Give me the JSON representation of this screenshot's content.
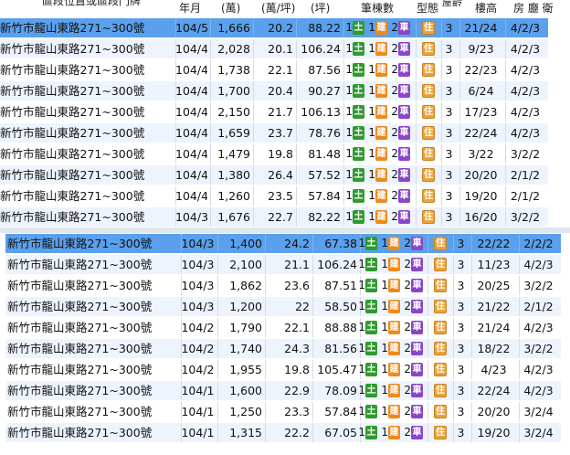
{
  "header": {
    "address": "區段位置或區段門牌",
    "year_month": "年月",
    "total_price": "(萬)",
    "unit_price": "(萬/坪)",
    "area": "(坪)",
    "counts": "筆棟數",
    "type": "型態",
    "age": "屋齡",
    "floor": "樓高",
    "layout": "房 廳 衛"
  },
  "top_table": {
    "rows": [
      {
        "address": "新竹市龍山東路271~300號",
        "ym": "104/5",
        "total": "1,666",
        "unit": "20.2",
        "area": "88.22",
        "land": "1",
        "land_icon": "土",
        "build": "1",
        "build_icon": "建",
        "car": "2",
        "car_icon": "車",
        "type": "住",
        "age": "3",
        "floor": "21/24",
        "layout": "4/2/3",
        "selected": true
      },
      {
        "address": "新竹市龍山東路271~300號",
        "ym": "104/4",
        "total": "2,028",
        "unit": "20.1",
        "area": "106.24",
        "land": "1",
        "land_icon": "土",
        "build": "1",
        "build_icon": "建",
        "car": "2",
        "car_icon": "車",
        "type": "住",
        "age": "3",
        "floor": "9/23",
        "layout": "4/2/3"
      },
      {
        "address": "新竹市龍山東路271~300號",
        "ym": "104/4",
        "total": "1,738",
        "unit": "22.1",
        "area": "87.56",
        "land": "1",
        "land_icon": "土",
        "build": "1",
        "build_icon": "建",
        "car": "2",
        "car_icon": "車",
        "type": "住",
        "age": "3",
        "floor": "22/23",
        "layout": "4/2/3"
      },
      {
        "address": "新竹市龍山東路271~300號",
        "ym": "104/4",
        "total": "1,700",
        "unit": "20.4",
        "area": "90.27",
        "land": "1",
        "land_icon": "土",
        "build": "1",
        "build_icon": "建",
        "car": "2",
        "car_icon": "車",
        "type": "住",
        "age": "3",
        "floor": "6/24",
        "layout": "4/2/3"
      },
      {
        "address": "新竹市龍山東路271~300號",
        "ym": "104/4",
        "total": "2,150",
        "unit": "21.7",
        "area": "106.13",
        "land": "1",
        "land_icon": "土",
        "build": "1",
        "build_icon": "建",
        "car": "2",
        "car_icon": "車",
        "type": "住",
        "age": "3",
        "floor": "17/23",
        "layout": "4/2/3"
      },
      {
        "address": "新竹市龍山東路271~300號",
        "ym": "104/4",
        "total": "1,659",
        "unit": "23.7",
        "area": "78.76",
        "land": "1",
        "land_icon": "土",
        "build": "1",
        "build_icon": "建",
        "car": "2",
        "car_icon": "車",
        "type": "住",
        "age": "3",
        "floor": "22/24",
        "layout": "4/2/3"
      },
      {
        "address": "新竹市龍山東路271~300號",
        "ym": "104/4",
        "total": "1,479",
        "unit": "19.8",
        "area": "81.48",
        "land": "1",
        "land_icon": "土",
        "build": "1",
        "build_icon": "建",
        "car": "2",
        "car_icon": "車",
        "type": "住",
        "age": "3",
        "floor": "3/22",
        "layout": "3/2/2"
      },
      {
        "address": "新竹市龍山東路271~300號",
        "ym": "104/4",
        "total": "1,380",
        "unit": "26.4",
        "area": "57.52",
        "land": "1",
        "land_icon": "土",
        "build": "1",
        "build_icon": "建",
        "car": "2",
        "car_icon": "車",
        "type": "住",
        "age": "3",
        "floor": "20/20",
        "layout": "2/1/2"
      },
      {
        "address": "新竹市龍山東路271~300號",
        "ym": "104/4",
        "total": "1,260",
        "unit": "23.5",
        "area": "57.84",
        "land": "1",
        "land_icon": "土",
        "build": "1",
        "build_icon": "建",
        "car": "2",
        "car_icon": "車",
        "type": "住",
        "age": "3",
        "floor": "19/20",
        "layout": "2/1/2"
      },
      {
        "address": "新竹市龍山東路271~300號",
        "ym": "104/3",
        "total": "1,676",
        "unit": "22.7",
        "area": "82.22",
        "land": "1",
        "land_icon": "土",
        "build": "1",
        "build_icon": "建",
        "car": "2",
        "car_icon": "車",
        "type": "住",
        "age": "3",
        "floor": "16/20",
        "layout": "3/2/2"
      }
    ]
  },
  "bottom_table": {
    "rows": [
      {
        "address": "新竹市龍山東路271~300號",
        "ym": "104/3",
        "total": "1,400",
        "unit": "24.2",
        "area": "67.38",
        "land": "1",
        "land_icon": "土",
        "build": "1",
        "build_icon": "建",
        "car": "2",
        "car_icon": "車",
        "type": "住",
        "age": "3",
        "floor": "22/22",
        "layout": "2/2/2",
        "selected": true
      },
      {
        "address": "新竹市龍山東路271~300號",
        "ym": "104/3",
        "total": "2,100",
        "unit": "21.1",
        "area": "106.24",
        "land": "1",
        "land_icon": "土",
        "build": "1",
        "build_icon": "建",
        "car": "2",
        "car_icon": "車",
        "type": "住",
        "age": "3",
        "floor": "11/23",
        "layout": "4/2/3"
      },
      {
        "address": "新竹市龍山東路271~300號",
        "ym": "104/3",
        "total": "1,862",
        "unit": "23.6",
        "area": "87.51",
        "land": "1",
        "land_icon": "土",
        "build": "1",
        "build_icon": "建",
        "car": "2",
        "car_icon": "車",
        "type": "住",
        "age": "3",
        "floor": "20/25",
        "layout": "3/2/2"
      },
      {
        "address": "新竹市龍山東路271~300號",
        "ym": "104/3",
        "total": "1,200",
        "unit": "22",
        "area": "58.50",
        "land": "1",
        "land_icon": "土",
        "build": "1",
        "build_icon": "建",
        "car": "2",
        "car_icon": "車",
        "type": "住",
        "age": "3",
        "floor": "21/22",
        "layout": "2/1/2"
      },
      {
        "address": "新竹市龍山東路271~300號",
        "ym": "104/2",
        "total": "1,790",
        "unit": "22.1",
        "area": "88.88",
        "land": "1",
        "land_icon": "土",
        "build": "1",
        "build_icon": "建",
        "car": "2",
        "car_icon": "車",
        "type": "住",
        "age": "3",
        "floor": "21/24",
        "layout": "4/2/3"
      },
      {
        "address": "新竹市龍山東路271~300號",
        "ym": "104/2",
        "total": "1,740",
        "unit": "24.3",
        "area": "81.56",
        "land": "1",
        "land_icon": "土",
        "build": "1",
        "build_icon": "建",
        "car": "2",
        "car_icon": "車",
        "type": "住",
        "age": "3",
        "floor": "18/22",
        "layout": "3/2/2"
      },
      {
        "address": "新竹市龍山東路271~300號",
        "ym": "104/2",
        "total": "1,955",
        "unit": "19.8",
        "area": "105.47",
        "land": "1",
        "land_icon": "土",
        "build": "1",
        "build_icon": "建",
        "car": "2",
        "car_icon": "車",
        "type": "住",
        "age": "3",
        "floor": "4/23",
        "layout": "4/2/3"
      },
      {
        "address": "新竹市龍山東路271~300號",
        "ym": "104/1",
        "total": "1,600",
        "unit": "22.9",
        "area": "78.09",
        "land": "1",
        "land_icon": "土",
        "build": "1",
        "build_icon": "建",
        "car": "2",
        "car_icon": "車",
        "type": "住",
        "age": "3",
        "floor": "22/24",
        "layout": "4/2/3"
      },
      {
        "address": "新竹市龍山東路271~300號",
        "ym": "104/1",
        "total": "1,250",
        "unit": "23.3",
        "area": "57.84",
        "land": "1",
        "land_icon": "土",
        "build": "1",
        "build_icon": "建",
        "car": "2",
        "car_icon": "車",
        "type": "住",
        "age": "3",
        "floor": "20/20",
        "layout": "3/2/4"
      },
      {
        "address": "新竹市龍山東路271~300號",
        "ym": "104/1",
        "total": "1,315",
        "unit": "22.2",
        "area": "67.05",
        "land": "1",
        "land_icon": "土",
        "build": "1",
        "build_icon": "建",
        "car": "2",
        "car_icon": "車",
        "type": "住",
        "age": "3",
        "floor": "19/20",
        "layout": "3/2/4"
      }
    ]
  },
  "colors": {
    "selected_row": "#5aa0ec",
    "odd_row": "#eef4fd",
    "land_badge": "#2e9b2e",
    "build_badge": "#ee8a1c",
    "car_badge": "#8a45c8",
    "type_badge": "#e8a23a"
  }
}
